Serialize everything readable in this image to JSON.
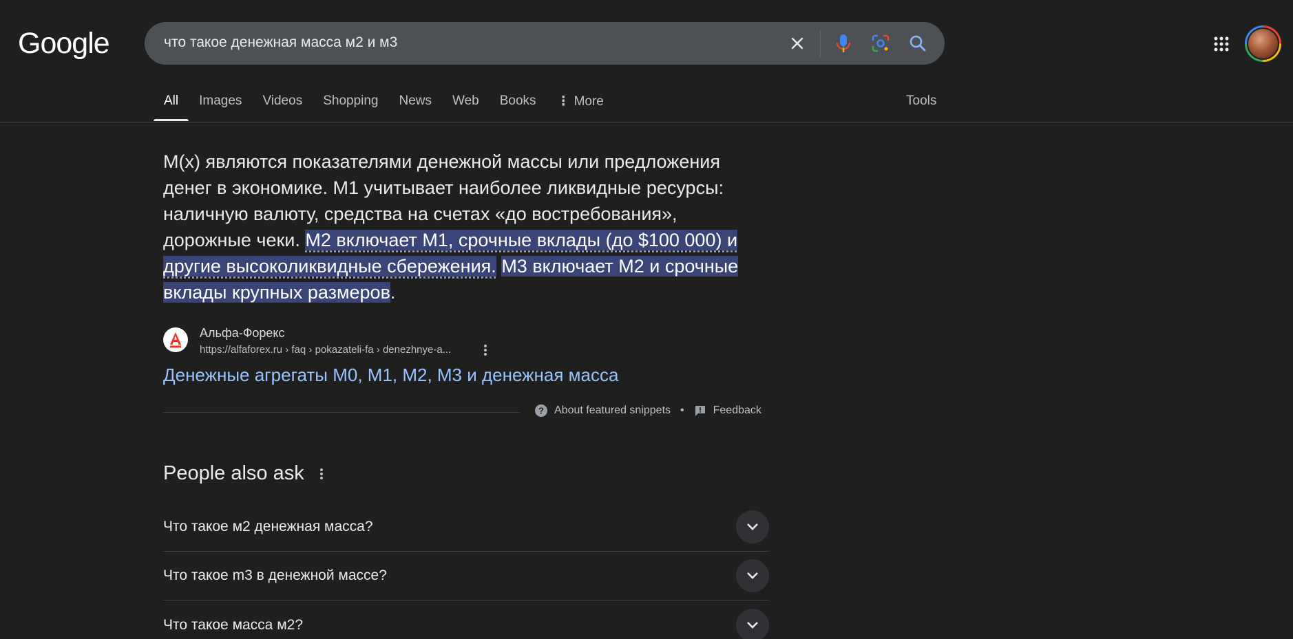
{
  "header": {
    "logo": "Google",
    "search_query": "что такое денежная масса м2 и м3"
  },
  "tabs": [
    {
      "label": "All",
      "active": true
    },
    {
      "label": "Images"
    },
    {
      "label": "Videos"
    },
    {
      "label": "Shopping"
    },
    {
      "label": "News"
    },
    {
      "label": "Web"
    },
    {
      "label": "Books"
    },
    {
      "label": "More"
    }
  ],
  "tools_label": "Tools",
  "snippet": {
    "text_plain": "M(x) являются показателями денежной массы или предложения денег в экономике. M1 учитывает наиболее ликвидные ресурсы: наличную валюту, средства на счетах «до востребования», дорожные чеки. ",
    "highlight_1": "M2 включает M1, срочные вклады (до $100 000) и другие высоколиквидные сбережения.",
    "highlight_2": "M3 включает M2 и срочные вклады крупных размеров",
    "tail": "."
  },
  "source": {
    "name": "Альфа-Форекс",
    "url": "https://alfaforex.ru › faq › pokazateli-fa › denezhnye-a...",
    "title": "Денежные агрегаты M0, M1, M2, M3 и денежная масса"
  },
  "featured": {
    "about_label": "About featured snippets",
    "separator": "•",
    "feedback_label": "Feedback"
  },
  "paa": {
    "title": "People also ask",
    "questions": [
      "Что такое м2 денежная масса?",
      "Что такое m3 в денежной массе?",
      "Что такое масса м2?"
    ]
  },
  "colors": {
    "background": "#1f1f1f",
    "search_box": "#4d5156",
    "link": "#99c3ff",
    "highlight": "#3b4476"
  }
}
